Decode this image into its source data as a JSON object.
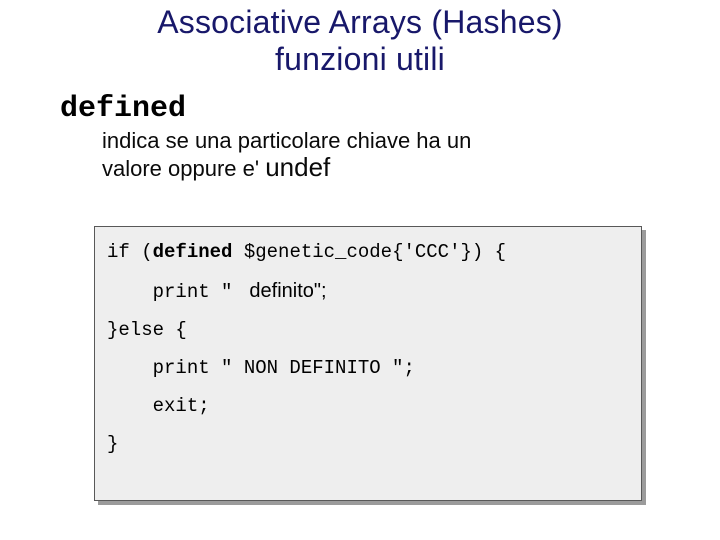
{
  "title_line1": "Associative Arrays (Hashes)",
  "title_line2": "funzioni utili",
  "keyword": "defined",
  "desc_line1": "indica se una particolare chiave  ha un",
  "desc_line2a": "valore oppure e' ",
  "desc_line2b": "undef",
  "code": {
    "l1a": "if (",
    "l1b": "defined",
    "l1c": " $genetic_code{'CCC'}) {",
    "l2a": "    print \" ",
    "l2b": " definito",
    "l2c": "\";",
    "l3": "}else {",
    "l4": "    print \" NON DEFINITO \";",
    "l5": "    exit;",
    "l6": "}"
  }
}
